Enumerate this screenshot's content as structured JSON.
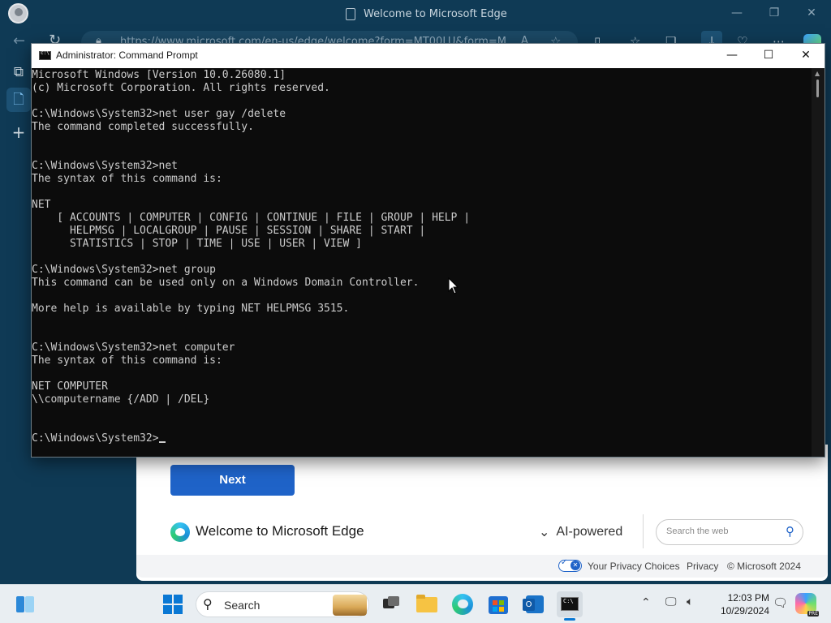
{
  "edge": {
    "window_title": "Welcome to Microsoft Edge",
    "url": "https://www.microsoft.com/en-us/edge/welcome?form=MT00LU&form=M",
    "next_button": "Next",
    "welcome_heading": "Welcome to Microsoft Edge",
    "ai_powered": "AI-powered",
    "search_placeholder": "Search the web",
    "privacy_choices": "Your Privacy Choices",
    "privacy": "Privacy",
    "copyright": "© Microsoft 2024"
  },
  "cmd": {
    "title": "Administrator: Command Prompt",
    "lines": [
      "Microsoft Windows [Version 10.0.26080.1]",
      "(c) Microsoft Corporation. All rights reserved.",
      "",
      "C:\\Windows\\System32>net user gay /delete",
      "The command completed successfully.",
      "",
      "",
      "C:\\Windows\\System32>net",
      "The syntax of this command is:",
      "",
      "NET",
      "    [ ACCOUNTS | COMPUTER | CONFIG | CONTINUE | FILE | GROUP | HELP |",
      "      HELPMSG | LOCALGROUP | PAUSE | SESSION | SHARE | START |",
      "      STATISTICS | STOP | TIME | USE | USER | VIEW ]",
      "",
      "C:\\Windows\\System32>net group",
      "This command can be used only on a Windows Domain Controller.",
      "",
      "More help is available by typing NET HELPMSG 3515.",
      "",
      "",
      "C:\\Windows\\System32>net computer",
      "The syntax of this command is:",
      "",
      "NET COMPUTER",
      "\\\\computername {/ADD | /DEL}",
      "",
      "",
      "C:\\Windows\\System32>"
    ]
  },
  "taskbar": {
    "search_label": "Search",
    "time": "12:03 PM",
    "date": "10/29/2024",
    "copilot_badge": "PRE"
  }
}
